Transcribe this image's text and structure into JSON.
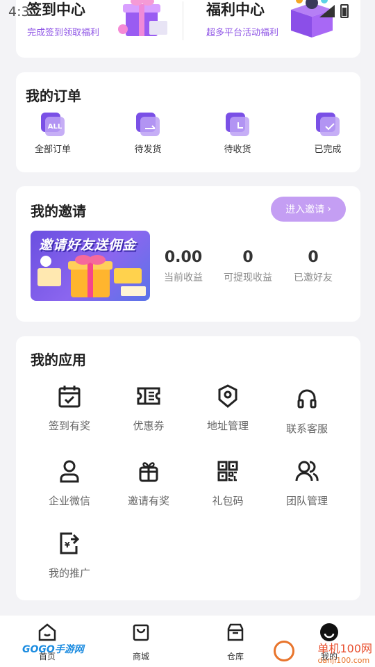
{
  "status": {
    "time": "4:3"
  },
  "top_card": {
    "checkin_title": "签到中心",
    "checkin_sub": "完成签到领取福利",
    "welfare_title": "福利中心",
    "welfare_sub": "超多平台活动福利"
  },
  "orders": {
    "title": "我的订单",
    "items": [
      {
        "label": "全部订单",
        "badge": "ALL",
        "icon": "all-orders-icon"
      },
      {
        "label": "待发货",
        "badge": "",
        "icon": "pending-ship-icon"
      },
      {
        "label": "待收货",
        "badge": "",
        "icon": "pending-receive-icon"
      },
      {
        "label": "已完成",
        "badge": "",
        "icon": "completed-icon"
      }
    ]
  },
  "invite": {
    "title": "我的邀请",
    "button": "进入邀请",
    "banner_text": "邀请好友送佣金",
    "stats": [
      {
        "value": "0.00",
        "label": "当前收益"
      },
      {
        "value": "0",
        "label": "可提现收益"
      },
      {
        "value": "0",
        "label": "已邀好友"
      }
    ]
  },
  "apps": {
    "title": "我的应用",
    "items": [
      {
        "label": "签到有奖",
        "icon": "calendar-check-icon"
      },
      {
        "label": "优惠券",
        "icon": "coupon-icon"
      },
      {
        "label": "地址管理",
        "icon": "location-icon"
      },
      {
        "label": "联系客服",
        "icon": "headset-icon"
      },
      {
        "label": "企业微信",
        "icon": "user-icon"
      },
      {
        "label": "邀请有奖",
        "icon": "gift-icon"
      },
      {
        "label": "礼包码",
        "icon": "qrcode-icon"
      },
      {
        "label": "团队管理",
        "icon": "team-icon"
      },
      {
        "label": "我的推广",
        "icon": "promotion-icon"
      }
    ]
  },
  "tabbar": {
    "items": [
      {
        "label": "首页",
        "icon": "home-icon"
      },
      {
        "label": "商城",
        "icon": "shop-bag-icon"
      },
      {
        "label": "仓库",
        "icon": "warehouse-icon"
      },
      {
        "label": "我的",
        "icon": "profile-icon"
      }
    ]
  },
  "watermarks": {
    "left": "GOGO手游网",
    "right": "单机100网",
    "right_sub": "danji100.com"
  },
  "colors": {
    "accent": "#8f55e6",
    "button": "#c49ef3"
  }
}
